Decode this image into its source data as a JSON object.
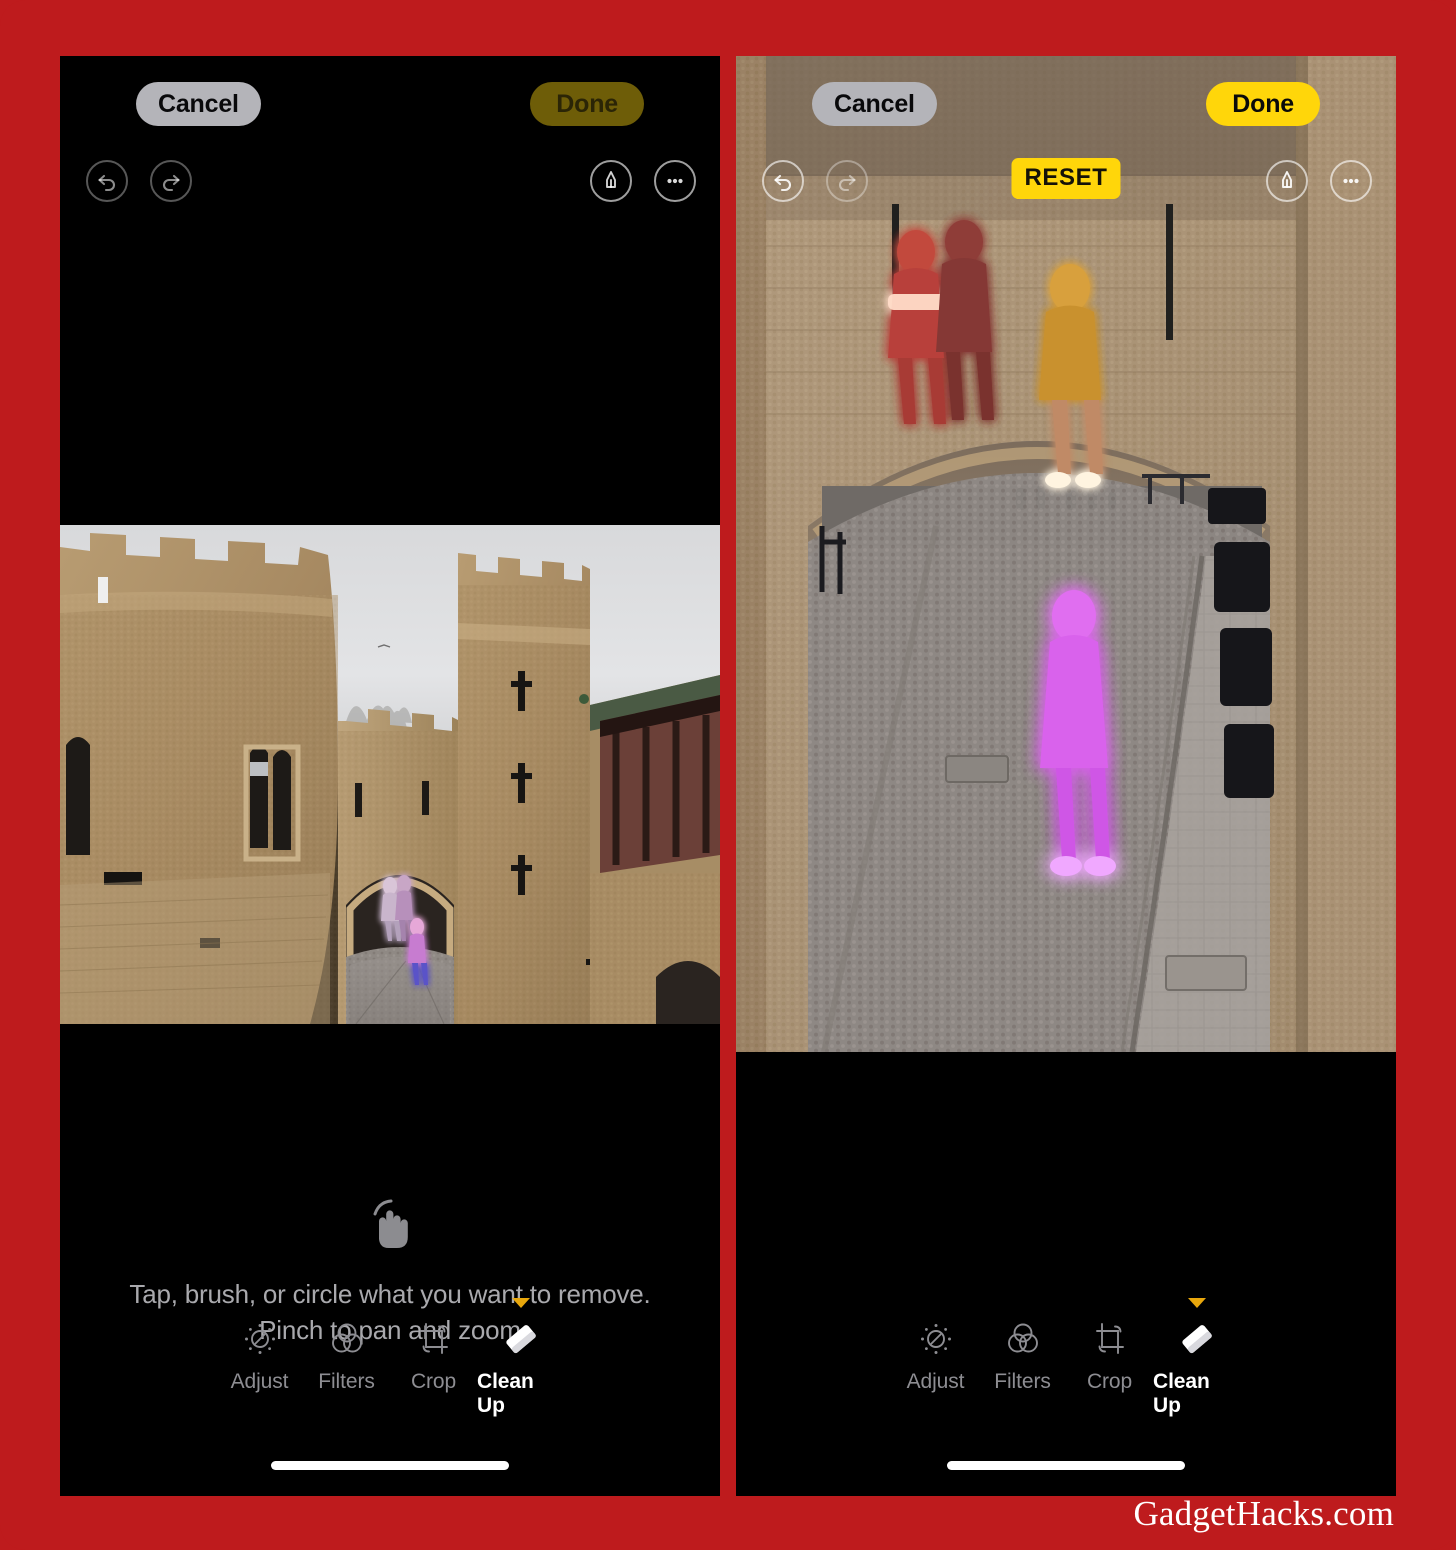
{
  "watermark": "GadgetHacks.com",
  "brand": {
    "frame_red": "#BE1B1D",
    "accent_yellow": "#FFD60A",
    "accent_yellow_dim": "#6E5D08"
  },
  "panels": [
    {
      "id": "before",
      "header": {
        "cancel_label": "Cancel",
        "done_label": "Done",
        "done_state": "dim"
      },
      "tools": {
        "undo_icon": "undo-icon",
        "redo_icon": "redo-icon",
        "markup_icon": "markup-pen-icon",
        "more_icon": "more-ellipsis-icon",
        "reset_label": "",
        "reset_visible": false
      },
      "hint": {
        "icon": "tap-hand-icon",
        "line1": "Tap, brush, or circle what you want to remove.",
        "line2": "Pinch to pan and zoom"
      },
      "toolbar": [
        {
          "label": "Adjust",
          "icon": "adjust-icon",
          "selected": false
        },
        {
          "label": "Filters",
          "icon": "filters-icon",
          "selected": false
        },
        {
          "label": "Crop",
          "icon": "crop-icon",
          "selected": false
        },
        {
          "label": "Clean Up",
          "icon": "cleanup-eraser-icon",
          "selected": true
        }
      ],
      "photo": {
        "alt": "Tower of London gateway, wide view with highlighted people",
        "zoom": "fit",
        "highlighted_subjects": 3
      }
    },
    {
      "id": "after",
      "header": {
        "cancel_label": "Cancel",
        "done_label": "Done",
        "done_state": "active"
      },
      "tools": {
        "undo_icon": "undo-icon",
        "redo_icon": "redo-icon",
        "markup_icon": "markup-pen-icon",
        "more_icon": "more-ellipsis-icon",
        "reset_label": "RESET",
        "reset_visible": true
      },
      "hint": {
        "icon": "",
        "line1": "",
        "line2": ""
      },
      "toolbar": [
        {
          "label": "Adjust",
          "icon": "adjust-icon",
          "selected": false
        },
        {
          "label": "Filters",
          "icon": "filters-icon",
          "selected": false
        },
        {
          "label": "Crop",
          "icon": "crop-icon",
          "selected": false
        },
        {
          "label": "Clean Up",
          "icon": "cleanup-eraser-icon",
          "selected": true
        }
      ],
      "photo": {
        "alt": "Tower of London gateway zoomed in, people glowing for removal",
        "zoom": "zoomed",
        "highlighted_subjects": 4
      }
    }
  ]
}
